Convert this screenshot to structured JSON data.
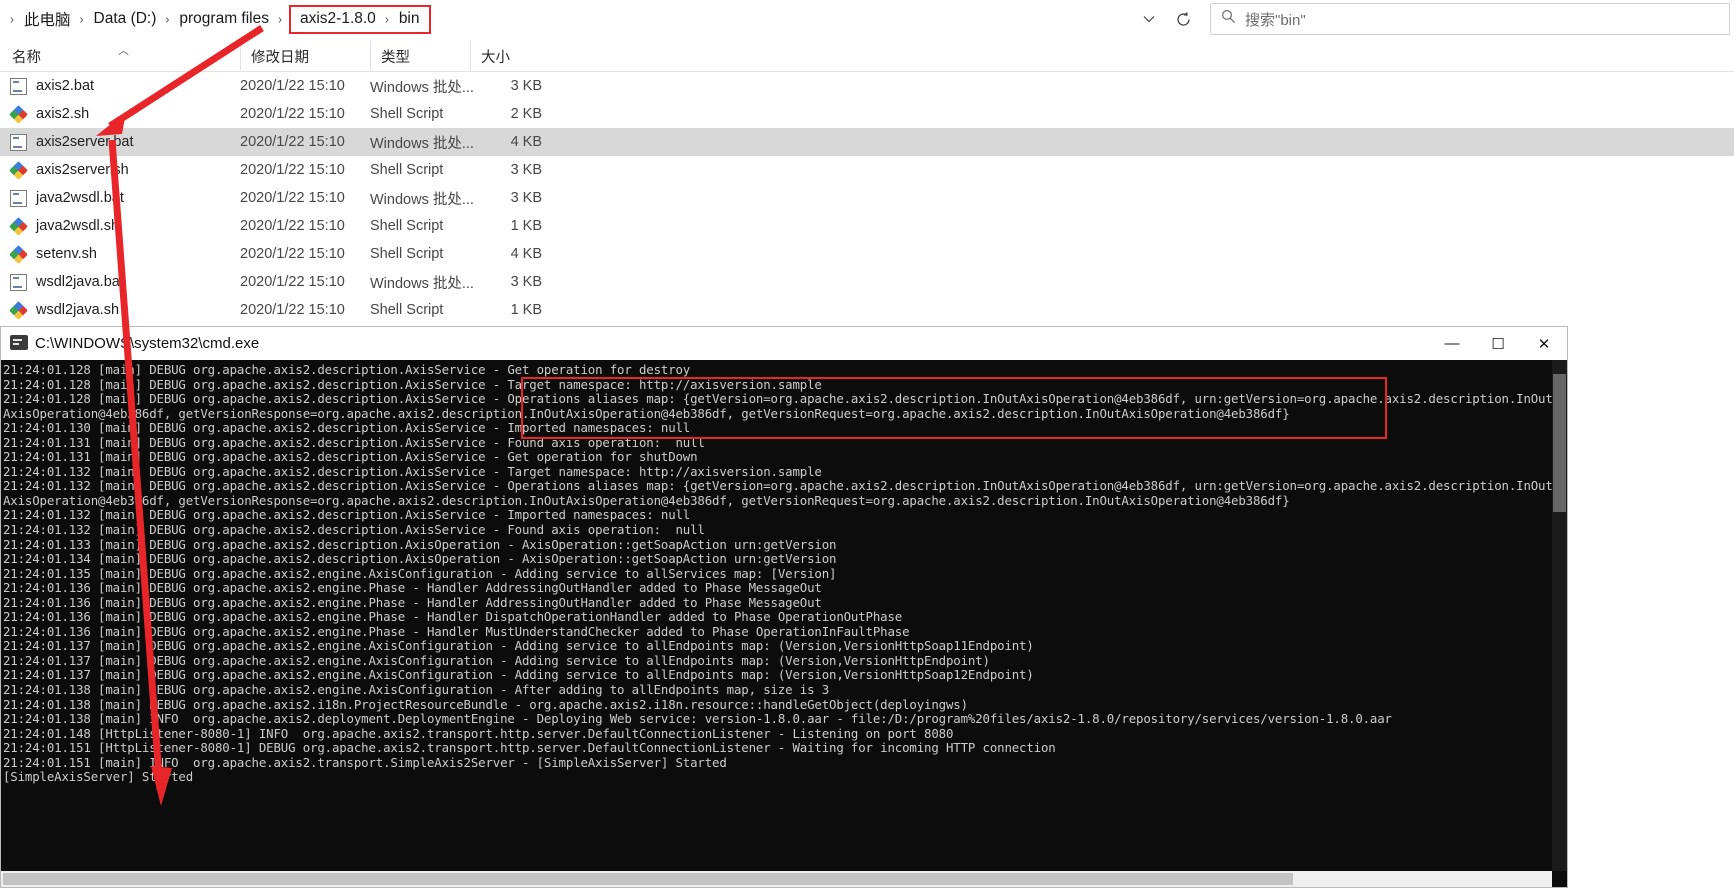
{
  "explorer": {
    "breadcrumb": {
      "items": [
        "此电脑",
        "Data (D:)",
        "program files"
      ],
      "highlighted": [
        "axis2-1.8.0",
        "bin"
      ],
      "separator": "›"
    },
    "refresh_icon": "refresh-icon",
    "chevron_icon": "chevron-down-icon",
    "search": {
      "icon": "search-icon",
      "placeholder": "搜索\"bin\""
    },
    "columns": [
      {
        "key": "name",
        "label": "名称"
      },
      {
        "key": "date",
        "label": "修改日期"
      },
      {
        "key": "type",
        "label": "类型"
      },
      {
        "key": "size",
        "label": "大小"
      }
    ],
    "sort_caret": "︿",
    "files": [
      {
        "name": "axis2.bat",
        "icon": "bat-file-icon",
        "date": "2020/1/22 15:10",
        "type": "Windows 批处...",
        "size": "3 KB",
        "selected": false
      },
      {
        "name": "axis2.sh",
        "icon": "shell-file-icon",
        "date": "2020/1/22 15:10",
        "type": "Shell Script",
        "size": "2 KB",
        "selected": false
      },
      {
        "name": "axis2server.bat",
        "icon": "bat-file-icon",
        "date": "2020/1/22 15:10",
        "type": "Windows 批处...",
        "size": "4 KB",
        "selected": true
      },
      {
        "name": "axis2server.sh",
        "icon": "shell-file-icon",
        "date": "2020/1/22 15:10",
        "type": "Shell Script",
        "size": "3 KB",
        "selected": false
      },
      {
        "name": "java2wsdl.bat",
        "icon": "bat-file-icon",
        "date": "2020/1/22 15:10",
        "type": "Windows 批处...",
        "size": "3 KB",
        "selected": false
      },
      {
        "name": "java2wsdl.sh",
        "icon": "shell-file-icon",
        "date": "2020/1/22 15:10",
        "type": "Shell Script",
        "size": "1 KB",
        "selected": false
      },
      {
        "name": "setenv.sh",
        "icon": "shell-file-icon",
        "date": "2020/1/22 15:10",
        "type": "Shell Script",
        "size": "4 KB",
        "selected": false
      },
      {
        "name": "wsdl2java.bat",
        "icon": "bat-file-icon",
        "date": "2020/1/22 15:10",
        "type": "Windows 批处...",
        "size": "3 KB",
        "selected": false
      },
      {
        "name": "wsdl2java.sh",
        "icon": "shell-file-icon",
        "date": "2020/1/22 15:10",
        "type": "Shell Script",
        "size": "1 KB",
        "selected": false
      }
    ]
  },
  "console": {
    "title": "C:\\WINDOWS\\system32\\cmd.exe",
    "icon": "cmd-icon",
    "window_buttons": {
      "minimize": "—",
      "maximize": "☐",
      "close": "✕"
    },
    "lines": [
      "21:24:01.128 [main] DEBUG org.apache.axis2.description.AxisService - Get operation for destroy",
      "21:24:01.128 [main] DEBUG org.apache.axis2.description.AxisService - Target namespace: http://axisversion.sample",
      "21:24:01.128 [main] DEBUG org.apache.axis2.description.AxisService - Operations aliases map: {getVersion=org.apache.axis2.description.InOutAxisOperation@4eb386df, urn:getVersion=org.apache.axis2.description.InOut",
      "AxisOperation@4eb386df, getVersionResponse=org.apache.axis2.description.InOutAxisOperation@4eb386df, getVersionRequest=org.apache.axis2.description.InOutAxisOperation@4eb386df}",
      "21:24:01.130 [main] DEBUG org.apache.axis2.description.AxisService - Imported namespaces: null",
      "21:24:01.131 [main] DEBUG org.apache.axis2.description.AxisService - Found axis operation:  null",
      "21:24:01.131 [main] DEBUG org.apache.axis2.description.AxisService - Get operation for shutDown",
      "21:24:01.132 [main] DEBUG org.apache.axis2.description.AxisService - Target namespace: http://axisversion.sample",
      "21:24:01.132 [main] DEBUG org.apache.axis2.description.AxisService - Operations aliases map: {getVersion=org.apache.axis2.description.InOutAxisOperation@4eb386df, urn:getVersion=org.apache.axis2.description.InOut",
      "AxisOperation@4eb386df, getVersionResponse=org.apache.axis2.description.InOutAxisOperation@4eb386df, getVersionRequest=org.apache.axis2.description.InOutAxisOperation@4eb386df}",
      "21:24:01.132 [main] DEBUG org.apache.axis2.description.AxisService - Imported namespaces: null",
      "21:24:01.132 [main] DEBUG org.apache.axis2.description.AxisService - Found axis operation:  null",
      "21:24:01.133 [main] DEBUG org.apache.axis2.description.AxisOperation - AxisOperation::getSoapAction urn:getVersion",
      "21:24:01.134 [main] DEBUG org.apache.axis2.description.AxisOperation - AxisOperation::getSoapAction urn:getVersion",
      "21:24:01.135 [main] DEBUG org.apache.axis2.engine.AxisConfiguration - Adding service to allServices map: [Version]",
      "21:24:01.136 [main] DEBUG org.apache.axis2.engine.Phase - Handler AddressingOutHandler added to Phase MessageOut",
      "21:24:01.136 [main] DEBUG org.apache.axis2.engine.Phase - Handler AddressingOutHandler added to Phase MessageOut",
      "21:24:01.136 [main] DEBUG org.apache.axis2.engine.Phase - Handler DispatchOperationHandler added to Phase OperationOutPhase",
      "21:24:01.136 [main] DEBUG org.apache.axis2.engine.Phase - Handler MustUnderstandChecker added to Phase OperationInFaultPhase",
      "21:24:01.137 [main] DEBUG org.apache.axis2.engine.AxisConfiguration - Adding service to allEndpoints map: (Version,VersionHttpSoap11Endpoint)",
      "21:24:01.137 [main] DEBUG org.apache.axis2.engine.AxisConfiguration - Adding service to allEndpoints map: (Version,VersionHttpEndpoint)",
      "21:24:01.137 [main] DEBUG org.apache.axis2.engine.AxisConfiguration - Adding service to allEndpoints map: (Version,VersionHttpSoap12Endpoint)",
      "21:24:01.138 [main] DEBUG org.apache.axis2.engine.AxisConfiguration - After adding to allEndpoints map, size is 3",
      "21:24:01.138 [main] DEBUG org.apache.axis2.i18n.ProjectResourceBundle - org.apache.axis2.i18n.resource::handleGetObject(deployingws)",
      "21:24:01.138 [main] INFO  org.apache.axis2.deployment.DeploymentEngine - Deploying Web service: version-1.8.0.aar - file:/D:/program%20files/axis2-1.8.0/repository/services/version-1.8.0.aar",
      "21:24:01.148 [HttpListener-8080-1] INFO  org.apache.axis2.transport.http.server.DefaultConnectionListener - Listening on port 8080",
      "21:24:01.151 [HttpListener-8080-1] DEBUG org.apache.axis2.transport.http.server.DefaultConnectionListener - Waiting for incoming HTTP connection",
      "21:24:01.151 [main] INFO  org.apache.axis2.transport.SimpleAxis2Server - [SimpleAxisServer] Started",
      "[SimpleAxisServer] Started"
    ]
  },
  "annotations": {
    "arrow_color": "#e8262a",
    "highlight_color": "#e8262a",
    "breadcrumb_highlight": "axis2-1.8.0 › bin",
    "arrow_target": "axis2server.bat",
    "console_highlight_note": "Deploying Web service / Listening on port 8080 / Waiting for incoming HTTP connection / [SimpleAxisServer] Started"
  }
}
